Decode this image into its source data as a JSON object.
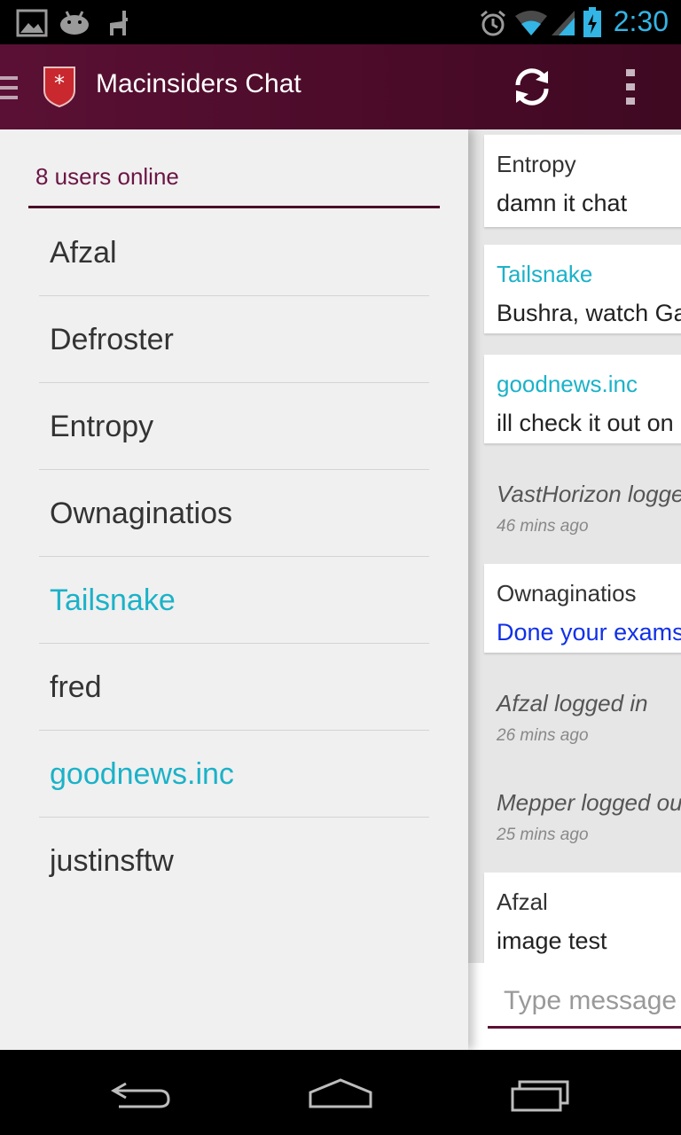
{
  "status_bar": {
    "time": "2:30"
  },
  "app_bar": {
    "title": "Macinsiders Chat"
  },
  "drawer": {
    "header": "8 users online",
    "users": [
      {
        "name": "Afzal",
        "color": "#333333"
      },
      {
        "name": "Defroster",
        "color": "#333333"
      },
      {
        "name": "Entropy",
        "color": "#333333"
      },
      {
        "name": "Ownaginatios",
        "color": "#333333"
      },
      {
        "name": "Tailsnake",
        "color": "#1bb2c8"
      },
      {
        "name": "fred",
        "color": "#333333"
      },
      {
        "name": "goodnews.inc",
        "color": "#1bb2c8"
      },
      {
        "name": "justinsftw",
        "color": "#333333"
      }
    ]
  },
  "chat": {
    "messages": [
      {
        "author": "Entropy",
        "text": "damn it chat"
      },
      {
        "author": "Tailsnake",
        "text": "Bushra, watch Ga"
      },
      {
        "author": "goodnews.inc",
        "text": "ill check it out on"
      },
      {
        "event": "VastHorizon logge",
        "time": "46 mins ago"
      },
      {
        "author": "Ownaginatios",
        "text": "Done your exams"
      },
      {
        "event": "Afzal logged in",
        "time": "26 mins ago"
      },
      {
        "event": "Mepper logged ou",
        "time": "25 mins ago"
      },
      {
        "author": "Afzal",
        "text": "image test"
      }
    ],
    "input_placeholder": "Type message"
  },
  "colors": {
    "action_bar": "#4a0b28",
    "accent_cyan": "#1bb2c8",
    "link_blue": "#1030e8",
    "status_blue": "#33b5e5"
  }
}
